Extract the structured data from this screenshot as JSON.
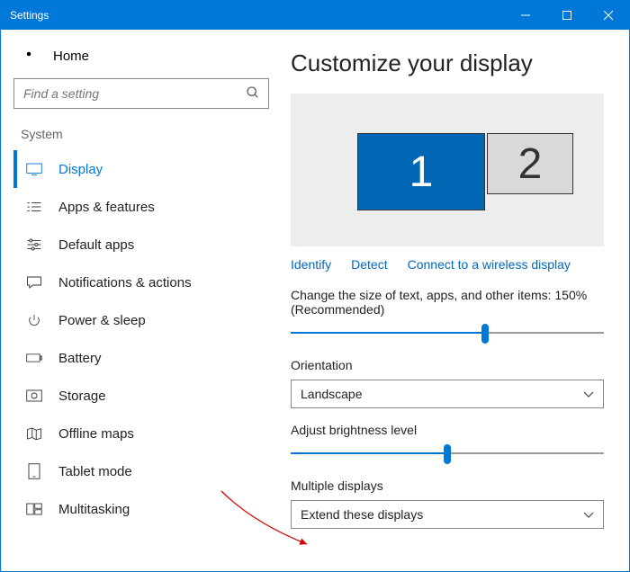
{
  "window": {
    "title": "Settings"
  },
  "sidebar": {
    "home": "Home",
    "search_placeholder": "Find a setting",
    "group": "System",
    "items": [
      {
        "label": "Display"
      },
      {
        "label": "Apps & features"
      },
      {
        "label": "Default apps"
      },
      {
        "label": "Notifications & actions"
      },
      {
        "label": "Power & sleep"
      },
      {
        "label": "Battery"
      },
      {
        "label": "Storage"
      },
      {
        "label": "Offline maps"
      },
      {
        "label": "Tablet mode"
      },
      {
        "label": "Multitasking"
      }
    ]
  },
  "main": {
    "heading": "Customize your display",
    "monitor1": "1",
    "monitor2": "2",
    "links": {
      "identify": "Identify",
      "detect": "Detect",
      "wireless": "Connect to a wireless display"
    },
    "scale_text": "Change the size of text, apps, and other items: 150% (Recommended)",
    "orientation_label": "Orientation",
    "orientation_value": "Landscape",
    "brightness_label": "Adjust brightness level",
    "multi_label": "Multiple displays",
    "multi_value": "Extend these displays"
  }
}
